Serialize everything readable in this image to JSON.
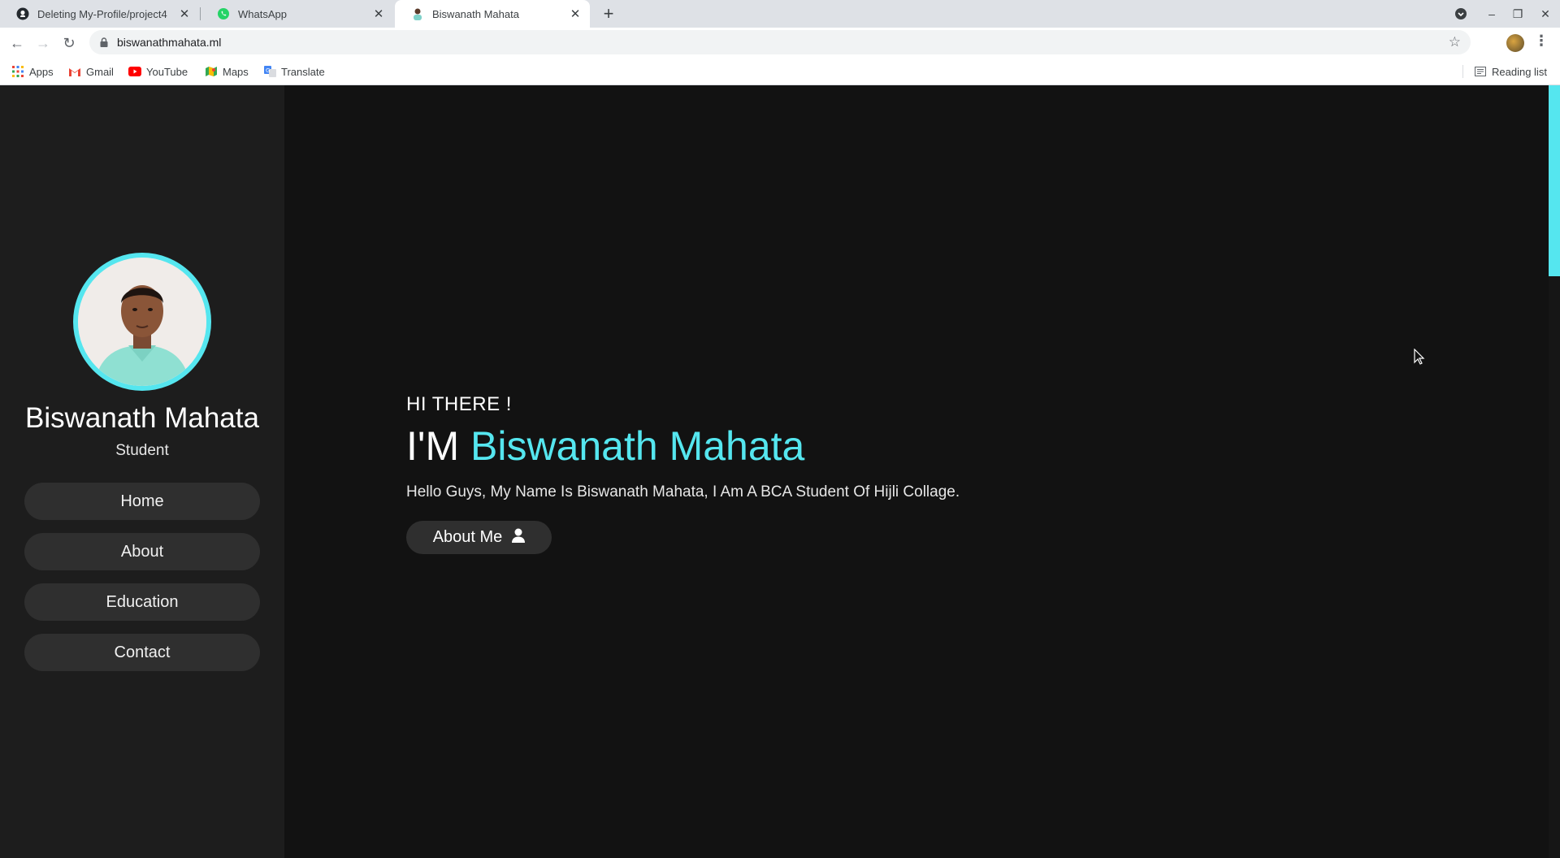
{
  "browser": {
    "tabs": [
      {
        "title": "Deleting My-Profile/project4",
        "icon": "github-icon",
        "active": false
      },
      {
        "title": "WhatsApp",
        "icon": "whatsapp-icon",
        "active": false
      },
      {
        "title": "Biswanath Mahata",
        "icon": "profile-favicon-icon",
        "active": true
      }
    ],
    "url": "biswanathmahata.ml",
    "bookmarks": [
      {
        "label": "Apps",
        "icon": "apps-grid-icon"
      },
      {
        "label": "Gmail",
        "icon": "gmail-icon"
      },
      {
        "label": "YouTube",
        "icon": "youtube-icon"
      },
      {
        "label": "Maps",
        "icon": "maps-icon"
      },
      {
        "label": "Translate",
        "icon": "translate-icon"
      }
    ],
    "reading_list": "Reading list"
  },
  "sidebar": {
    "name": "Biswanath Mahata",
    "role": "Student",
    "nav": [
      {
        "label": "Home"
      },
      {
        "label": "About"
      },
      {
        "label": "Education"
      },
      {
        "label": "Contact"
      }
    ]
  },
  "hero": {
    "greeting": "HI THERE !",
    "prefix": "I'M",
    "name": "Biswanath Mahata",
    "description": "Hello Guys, My Name Is Biswanath Mahata, I Am A BCA Student Of Hijli Collage.",
    "button_label": "About Me",
    "button_icon": "user-icon"
  },
  "colors": {
    "accent": "#55e6ef",
    "sidebar_bg": "#1d1d1d",
    "page_bg": "#121212",
    "button_bg": "#2f2f2f"
  }
}
